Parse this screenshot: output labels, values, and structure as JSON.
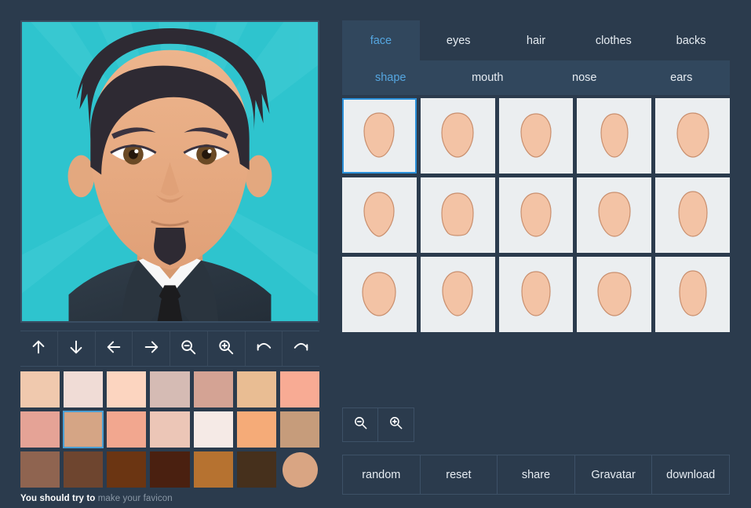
{
  "app": {
    "background_color": "#2b3b4d",
    "accent_color": "#2a90d9",
    "panel_color": "#31475d"
  },
  "avatar": {
    "name": "avatar-preview",
    "background_color": "#2ec4ce",
    "background_ray_color": "#3ccbd4",
    "skin_color": "#e8ab82",
    "skin_shadow": "#d9a583",
    "hair_color": "#2e2a33",
    "eye_color": "#6b4a25",
    "suit_color": "#2b3640",
    "shirt_color": "#f7f7f7",
    "tie_color": "#1c1c1e"
  },
  "toolbar": {
    "buttons": [
      {
        "name": "move-up-button",
        "icon": "arrow-up-icon"
      },
      {
        "name": "move-down-button",
        "icon": "arrow-down-icon"
      },
      {
        "name": "move-left-button",
        "icon": "arrow-left-icon"
      },
      {
        "name": "move-right-button",
        "icon": "arrow-right-icon"
      },
      {
        "name": "zoom-out-button",
        "icon": "magnifier-minus-icon"
      },
      {
        "name": "zoom-in-button",
        "icon": "magnifier-plus-icon"
      },
      {
        "name": "undo-button",
        "icon": "undo-icon"
      },
      {
        "name": "redo-button",
        "icon": "redo-icon"
      }
    ]
  },
  "palette": {
    "selected_index": 8,
    "current_color": "#d9a583",
    "colors": [
      "#f0c9ae",
      "#f0dcd6",
      "#fcd5c0",
      "#d5bbb4",
      "#d4a394",
      "#e9bd93",
      "#f8ab94",
      "#e5a396",
      "#d5a585",
      "#f2a78f",
      "#ecc6b7",
      "#f5eae6",
      "#f5ab78",
      "#c69c7b",
      "#8f6450",
      "#6e452f",
      "#6b3512",
      "#4a2010",
      "#b67230",
      "#46301c",
      "#2b3b4d"
    ]
  },
  "footer": {
    "prefix": "You should try to",
    "link_label": "make your favicon"
  },
  "tabs": {
    "primary": [
      {
        "label": "face",
        "active": true
      },
      {
        "label": "eyes",
        "active": false
      },
      {
        "label": "hair",
        "active": false
      },
      {
        "label": "clothes",
        "active": false
      },
      {
        "label": "backs",
        "active": false
      }
    ],
    "secondary": [
      {
        "label": "shape",
        "active": true
      },
      {
        "label": "mouth",
        "active": false
      },
      {
        "label": "nose",
        "active": false
      },
      {
        "label": "ears",
        "active": false
      }
    ]
  },
  "option_grid": {
    "columns": 5,
    "rows": 3,
    "selected_index": 0,
    "cell_background": "#ebeef0",
    "shape_fill": "#f3c3a5",
    "shape_stroke": "#c98f6e",
    "items": [
      {
        "name": "face-shape-1",
        "shape": "oval-tapered"
      },
      {
        "name": "face-shape-2",
        "shape": "oval-round"
      },
      {
        "name": "face-shape-3",
        "shape": "oval-wide"
      },
      {
        "name": "face-shape-4",
        "shape": "oval-narrow"
      },
      {
        "name": "face-shape-5",
        "shape": "oval-soft"
      },
      {
        "name": "face-shape-6",
        "shape": "pointed-chin"
      },
      {
        "name": "face-shape-7",
        "shape": "square-jaw"
      },
      {
        "name": "face-shape-8",
        "shape": "rounded-jaw"
      },
      {
        "name": "face-shape-9",
        "shape": "heart"
      },
      {
        "name": "face-shape-10",
        "shape": "long-oval"
      },
      {
        "name": "face-shape-11",
        "shape": "wide-round"
      },
      {
        "name": "face-shape-12",
        "shape": "diamond"
      },
      {
        "name": "face-shape-13",
        "shape": "egg"
      },
      {
        "name": "face-shape-14",
        "shape": "broad"
      },
      {
        "name": "face-shape-15",
        "shape": "tall"
      }
    ]
  },
  "zoom_controls": [
    {
      "name": "preview-zoom-out-button",
      "icon": "magnifier-minus-icon"
    },
    {
      "name": "preview-zoom-in-button",
      "icon": "magnifier-plus-icon"
    }
  ],
  "actions": [
    {
      "name": "random-button",
      "label": "random"
    },
    {
      "name": "reset-button",
      "label": "reset"
    },
    {
      "name": "share-button",
      "label": "share"
    },
    {
      "name": "gravatar-button",
      "label": "Gravatar"
    },
    {
      "name": "download-button",
      "label": "download"
    }
  ]
}
